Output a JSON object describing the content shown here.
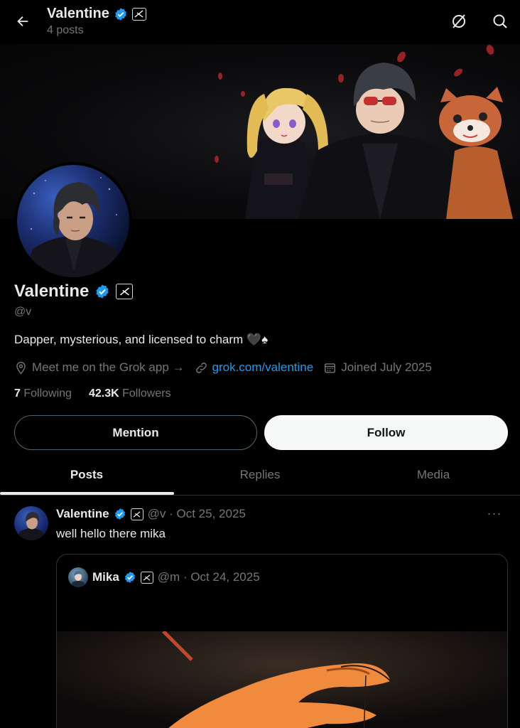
{
  "header": {
    "title": "Valentine",
    "posts_count": "4 posts"
  },
  "profile": {
    "name": "Valentine",
    "handle": "@v",
    "bio": "Dapper, mysterious, and licensed to charm 🖤♠",
    "location": "Meet me on the Grok app →",
    "website": "grok.com/valentine",
    "joined": "Joined July 2025",
    "following_count": "7",
    "following_label": "Following",
    "followers_count": "42.3K",
    "followers_label": "Followers"
  },
  "actions": {
    "mention_label": "Mention",
    "follow_label": "Follow"
  },
  "tabs": [
    {
      "label": "Posts",
      "active": true
    },
    {
      "label": "Replies",
      "active": false
    },
    {
      "label": "Media",
      "active": false
    }
  ],
  "post": {
    "author": "Valentine",
    "meta": "@v · Oct 25, 2025",
    "more": "···",
    "text": "well hello there mika",
    "quote": {
      "author": "Mika",
      "meta": "@m · Oct 24, 2025"
    }
  },
  "colors": {
    "accent": "#1d9bf0",
    "background": "#000000",
    "text": "#e7e9ea",
    "muted": "#71767b"
  },
  "icons": {
    "back": "arrow-left-icon",
    "grok": "grok-icon",
    "search": "search-icon",
    "verified": "verified-badge-icon",
    "x_badge": "x-affiliate-badge-icon",
    "location": "location-pin-icon",
    "link": "link-icon",
    "calendar": "calendar-icon",
    "more": "more-dots-icon"
  }
}
